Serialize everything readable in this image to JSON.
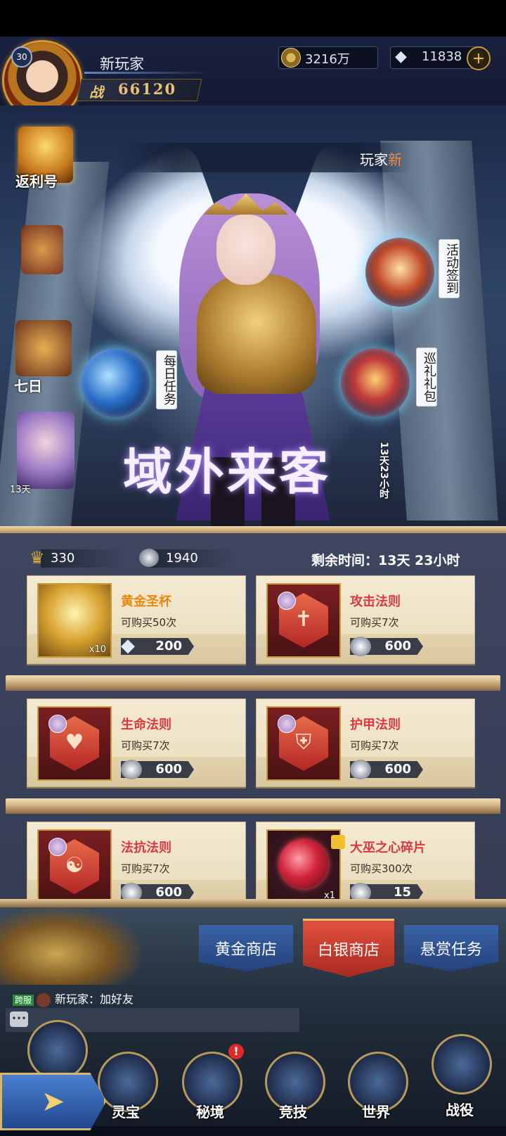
{
  "header": {
    "level": "30",
    "player_name": "新玩家",
    "power_label": "战",
    "power_value": "66120",
    "coins": "3216万",
    "gems": "11838",
    "add_label": "+"
  },
  "banner": {
    "user_text": "玩家",
    "user_tag": "新",
    "title": "域外来客",
    "timer": "13天23小时",
    "side_fanli": "返利号",
    "side_seven": "七日",
    "side_portrait_text": "13天",
    "daily_task": "每日任务",
    "signin": "活动签到",
    "gift": "巡礼礼包"
  },
  "shop": {
    "trophy_count": "330",
    "silver_count": "1940",
    "remaining": "剩余时间：13天 23小时",
    "items": [
      {
        "name": "黄金圣杯",
        "limit": "可购买50次",
        "price": "200",
        "qty": "x10",
        "currency": "gem"
      },
      {
        "name": "攻击法则",
        "limit": "可购买7次",
        "price": "600",
        "currency": "silver"
      },
      {
        "name": "生命法则",
        "limit": "可购买7次",
        "price": "600",
        "currency": "silver"
      },
      {
        "name": "护甲法则",
        "limit": "可购买7次",
        "price": "600",
        "currency": "silver"
      },
      {
        "name": "法抗法则",
        "limit": "可购买7次",
        "price": "600",
        "currency": "silver"
      },
      {
        "name": "大巫之心碎片",
        "limit": "可购买300次",
        "price": "15",
        "qty": "x1",
        "currency": "silver"
      }
    ]
  },
  "tabs": {
    "gold": "黄金商店",
    "silver": "白银商店",
    "bounty": "悬赏任务"
  },
  "chat": {
    "tag": "跨服",
    "message": "新玩家：加好友"
  },
  "nav": {
    "lingbao": "灵宝",
    "mijing": "秘境",
    "jingji": "竞技",
    "shijie": "世界",
    "zhanyi": "战役",
    "notif": "!"
  }
}
